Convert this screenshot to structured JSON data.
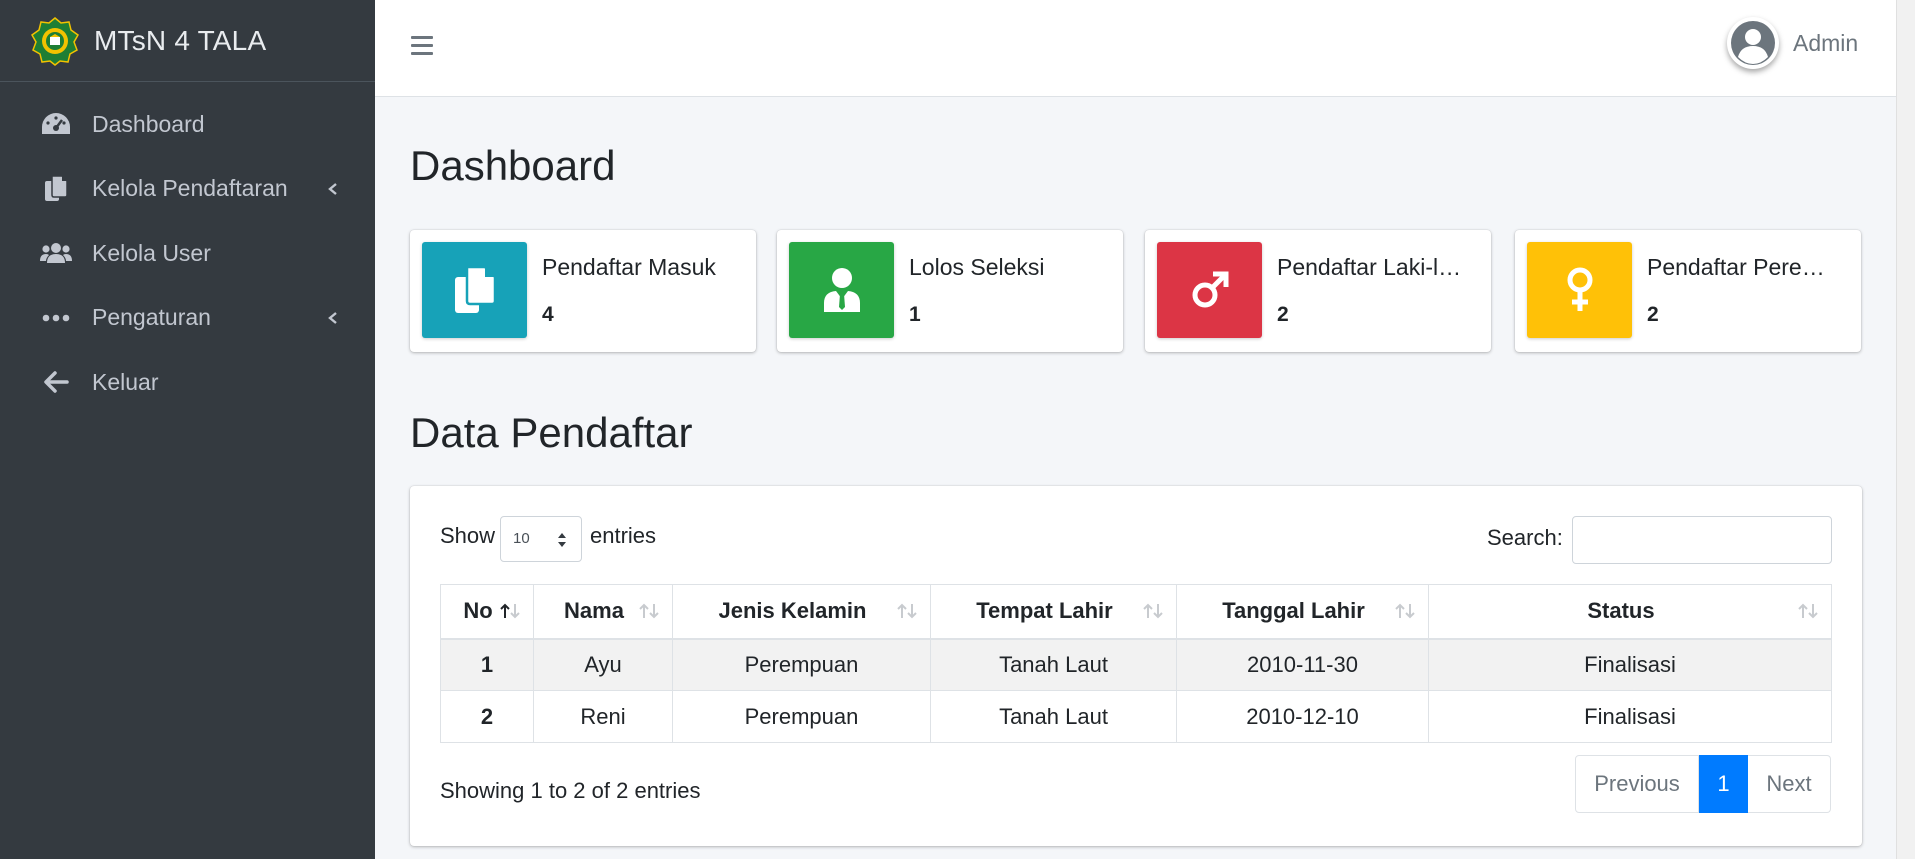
{
  "brand": {
    "name": "MTsN 4 TALA"
  },
  "sidebar": {
    "items": [
      {
        "label": "Dashboard",
        "icon": "tachometer-icon",
        "has_submenu": false
      },
      {
        "label": "Kelola Pendaftaran",
        "icon": "copy-icon",
        "has_submenu": true
      },
      {
        "label": "Kelola User",
        "icon": "users-icon",
        "has_submenu": false
      },
      {
        "label": "Pengaturan",
        "icon": "ellipsis-icon",
        "has_submenu": true
      },
      {
        "label": "Keluar",
        "icon": "arrow-left-icon",
        "has_submenu": false
      }
    ]
  },
  "topbar": {
    "user_name": "Admin",
    "menu_icon": "hamburger-icon",
    "avatar_icon": "user-avatar-icon"
  },
  "page": {
    "title": "Dashboard"
  },
  "stats": [
    {
      "label": "Pendaftar Masuk",
      "value": "4",
      "color": "#17a2b8",
      "icon": "copy-icon"
    },
    {
      "label": "Lolos Seleksi",
      "value": "1",
      "color": "#28a745",
      "icon": "user-tie-icon"
    },
    {
      "label": "Pendaftar Laki-l…",
      "value": "2",
      "color": "#dc3545",
      "icon": "mars-icon"
    },
    {
      "label": "Pendaftar Pere…",
      "value": "2",
      "color": "#ffc107",
      "icon": "venus-icon"
    }
  ],
  "registrants": {
    "title": "Data Pendaftar",
    "show_label": "Show",
    "page_size": "10",
    "entries_label": "entries",
    "search_label": "Search:",
    "search_value": "",
    "columns": [
      "No",
      "Nama",
      "Jenis Kelamin",
      "Tempat Lahir",
      "Tanggal Lahir",
      "Status"
    ],
    "rows": [
      [
        "1",
        "Ayu",
        "Perempuan",
        "Tanah Laut",
        "2010-11-30",
        "Finalisasi"
      ],
      [
        "2",
        "Reni",
        "Perempuan",
        "Tanah Laut",
        "2010-12-10",
        "Finalisasi"
      ]
    ],
    "footer_info": "Showing 1 to 2 of 2 entries",
    "pagination": {
      "previous": "Previous",
      "current": "1",
      "next": "Next"
    }
  }
}
